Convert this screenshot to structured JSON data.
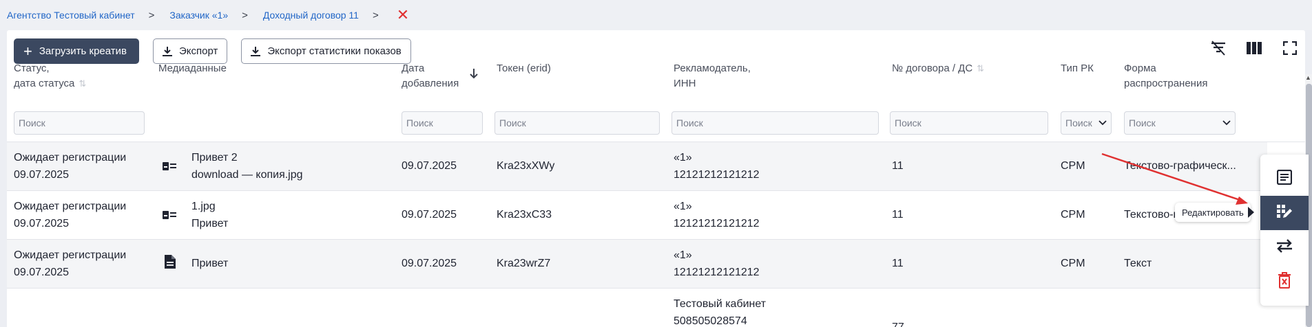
{
  "breadcrumbs": {
    "items": [
      "Агентство Тестовый кабинет",
      "Заказчик «1»",
      "Доходный договор 11"
    ],
    "separator": ">",
    "close_symbol": "✕"
  },
  "toolbar": {
    "upload_label": "Загрузить креатив",
    "export_label": "Экспорт",
    "export_stats_label": "Экспорт статистики показов"
  },
  "top_icons": [
    "clear-filter-icon",
    "columns-icon",
    "fullscreen-icon"
  ],
  "table": {
    "headers": {
      "status": [
        "Статус,",
        "дата статуса"
      ],
      "media": "Медиаданные",
      "date_added": [
        "Дата",
        "добавления"
      ],
      "token": "Токен (erid)",
      "advertiser": [
        "Рекламодатель,",
        "ИНН"
      ],
      "contract": "№ договора / ДС",
      "rk_type": "Тип РК",
      "form": [
        "Форма",
        "распространения"
      ]
    },
    "filter_placeholder": "Поиск",
    "rows": [
      {
        "status": "Ожидает регистрации",
        "status_date": "09.07.2025",
        "media_icon": "media-card-icon",
        "media_line1": "Привет 2",
        "media_line2": "download — копия.jpg",
        "date_added": "09.07.2025",
        "token": "Kra23xXWy",
        "advertiser": "«1»",
        "inn": "12121212121212",
        "contract": "11",
        "rk_type": "CPM",
        "form": "Текстово-графическ..."
      },
      {
        "status": "Ожидает регистрации",
        "status_date": "09.07.2025",
        "media_icon": "media-card-icon",
        "media_line1": "1.jpg",
        "media_line2": "Привет",
        "date_added": "09.07.2025",
        "token": "Kra23xC33",
        "advertiser": "«1»",
        "inn": "12121212121212",
        "contract": "11",
        "rk_type": "CPM",
        "form": "Текстово-г"
      },
      {
        "status": "Ожидает регистрации",
        "status_date": "09.07.2025",
        "media_icon": "document-icon",
        "media_line1": "Привет",
        "media_line2": "",
        "date_added": "09.07.2025",
        "token": "Kra23wrZ7",
        "advertiser": "«1»",
        "inn": "12121212121212",
        "contract": "11",
        "rk_type": "CPM",
        "form": "Текст"
      },
      {
        "status": "",
        "status_date": "",
        "media_icon": "",
        "media_line1": "",
        "media_line2": "",
        "date_added": "",
        "token": "",
        "advertiser": "Тестовый кабинет",
        "inn": "508505028574",
        "contract": "77",
        "rk_type": "",
        "form": ""
      }
    ]
  },
  "side_panel": {
    "items": [
      "details-icon",
      "edit-icon",
      "swap-icon",
      "delete-icon"
    ],
    "active": "edit-icon",
    "tooltip": "Редактировать"
  },
  "colors": {
    "accent": "#3b4860",
    "link": "#2166c7",
    "danger": "#e03131",
    "annotation_arrow": "#e03131"
  }
}
